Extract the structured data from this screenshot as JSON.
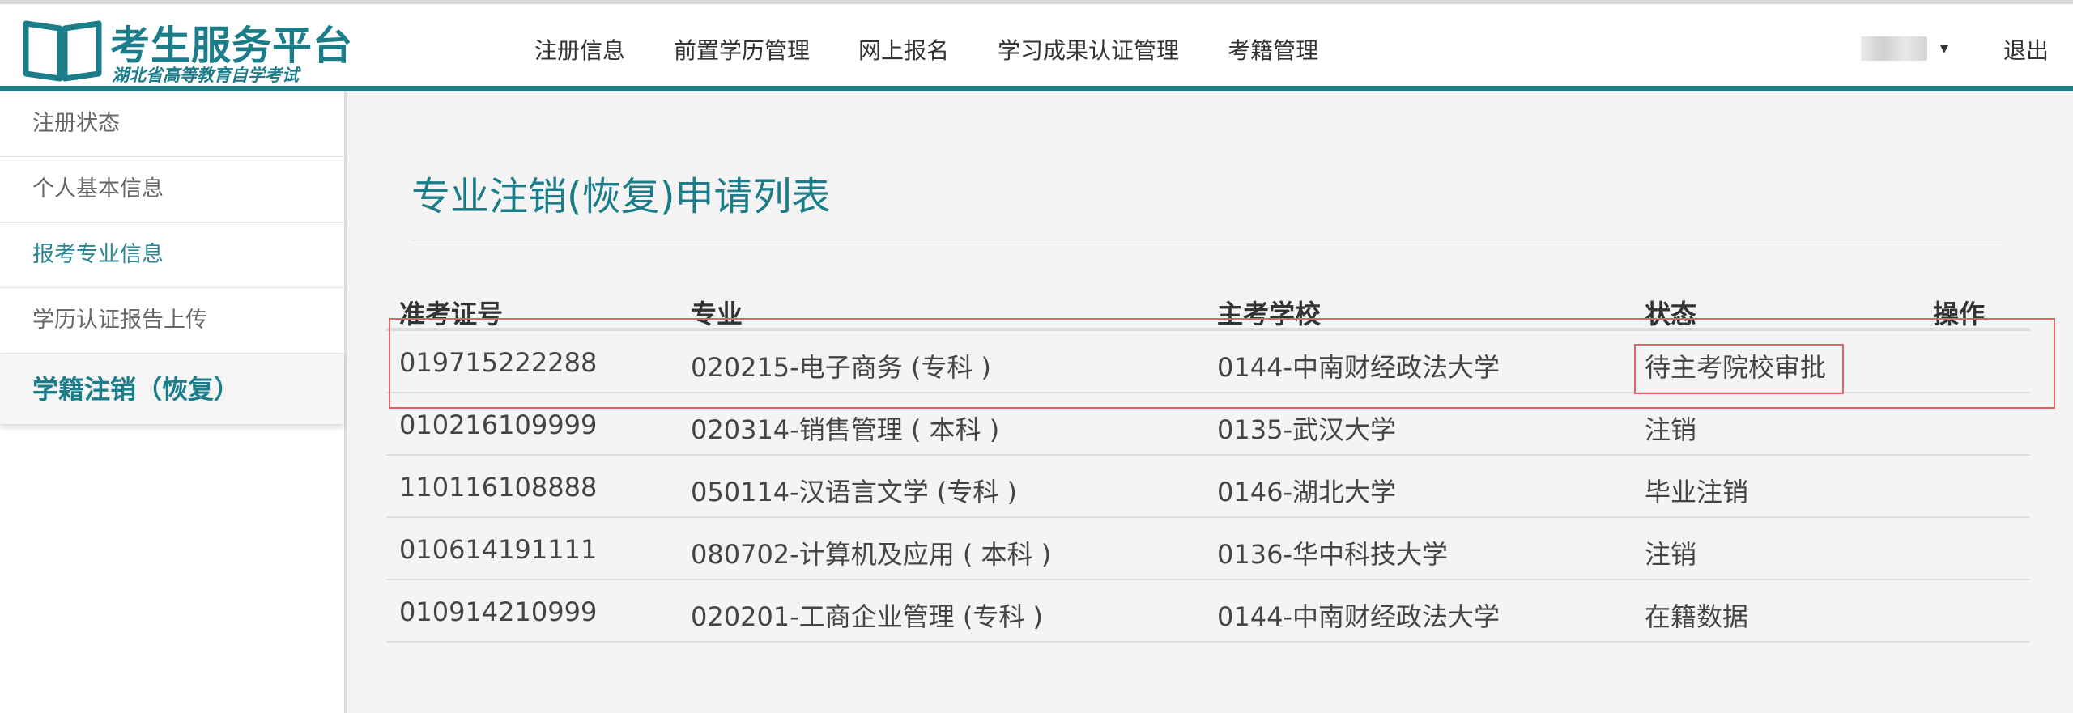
{
  "header": {
    "logo_title": "考生服务平台",
    "logo_subtitle": "湖北省高等教育自学考试",
    "nav": [
      "注册信息",
      "前置学历管理",
      "网上报名",
      "学习成果认证管理",
      "考籍管理"
    ],
    "logout": "退出",
    "user_caret_icon": "caret-down-icon"
  },
  "sidebar": {
    "items": [
      {
        "label": "注册状态"
      },
      {
        "label": "个人基本信息"
      },
      {
        "label": "报考专业信息"
      },
      {
        "label": "学历认证报告上传"
      },
      {
        "label": "学籍注销（恢复）"
      }
    ]
  },
  "main": {
    "title": "专业注销(恢复)申请列表",
    "table": {
      "headers": [
        "准考证号",
        "专业",
        "主考学校",
        "状态",
        "操作"
      ],
      "rows": [
        {
          "id": "019715222288",
          "major": "020215-电子商务 (专科 )",
          "school": "0144-中南财经政法大学",
          "status": "待主考院校审批"
        },
        {
          "id": "010216109999",
          "major": "020314-销售管理 ( 本科 )",
          "school": "0135-武汉大学",
          "status": "注销"
        },
        {
          "id": "110116108888",
          "major": "050114-汉语言文学 (专科 )",
          "school": "0146-湖北大学",
          "status": "毕业注销"
        },
        {
          "id": "010614191111",
          "major": "080702-计算机及应用 ( 本科 )",
          "school": "0136-华中科技大学",
          "status": "注销"
        },
        {
          "id": "010914210999",
          "major": "020201-工商企业管理 (专科 )",
          "school": "0144-中南财经政法大学",
          "status": "在籍数据"
        }
      ]
    }
  },
  "colors": {
    "accent": "#1b7d89",
    "highlight": "#e06262"
  }
}
